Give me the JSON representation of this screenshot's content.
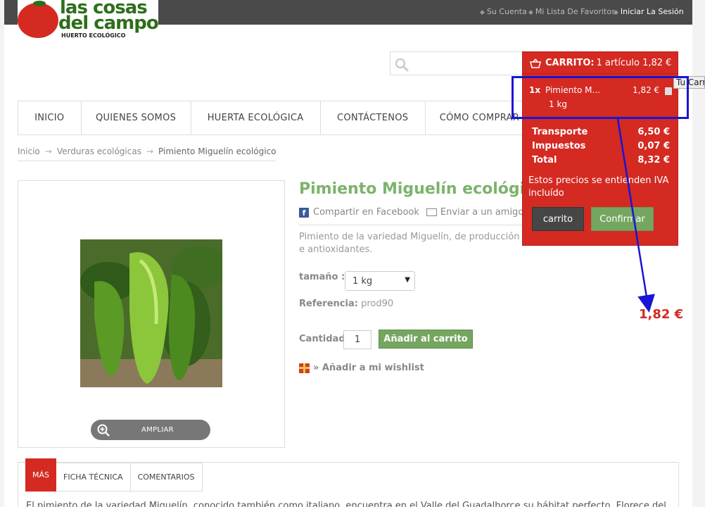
{
  "header": {
    "links": [
      {
        "label": "Su Cuenta"
      },
      {
        "label": "Mi Lista De Favoritos"
      },
      {
        "label": "Iniciar La Sesión"
      }
    ],
    "logo": {
      "line1": "las cosas",
      "line2": "del campo",
      "line3": "HUERTO ECOLÓGICO"
    }
  },
  "search": {
    "placeholder": "",
    "value": ""
  },
  "nav": {
    "items": [
      {
        "label": "INICIO"
      },
      {
        "label": "QUIENES SOMOS"
      },
      {
        "label": "HUERTA ECOLÓGICA"
      },
      {
        "label": "CONTÁCTENOS"
      },
      {
        "label": "CÓMO COMPRAR"
      }
    ]
  },
  "breadcrumb": {
    "items": [
      "Inicio",
      "Verduras ecológicas",
      "Pimiento Miguelín ecológico"
    ]
  },
  "product": {
    "title": "Pimiento Miguelín ecológico",
    "share_facebook": "Compartir en Facebook",
    "send_friend": "Enviar a un amigo",
    "description": "Pimiento de la variedad Miguelín, de producción e antioxidantes.",
    "size_label": "tamaño :",
    "size_value": "1 kg",
    "reference_label": "Referencia:",
    "reference_value": "prod90",
    "quantity_label": "Cantidad",
    "quantity_value": "1",
    "add_to_cart": "Añadir al carrito",
    "wishlist": "» Añadir a mi wishlist",
    "zoom_label": "AMPLIAR"
  },
  "tabs": {
    "items": [
      {
        "label": "MÁS",
        "active": true
      },
      {
        "label": "FICHA TÉCNICA",
        "active": false
      },
      {
        "label": "COMENTARIOS",
        "active": false
      }
    ],
    "content": "El pimiento de la variedad Miguelín, conocido también como italiano, encuentra en el Valle del Guadalhorce su hábitat perfecto. Florece del"
  },
  "cart": {
    "title": "CARRITO:",
    "summary": "1 artículo 1,82 €",
    "item": {
      "qty": "1x",
      "name": "Pimiento M...",
      "price": "1,82 €",
      "attribute": "1 kg"
    },
    "totals": [
      {
        "label": "Transporte",
        "value": "6,50 €"
      },
      {
        "label": "Impuestos",
        "value": "0,07 €"
      },
      {
        "label": "Total",
        "value": "8,32 €"
      }
    ],
    "note": "Estos precios se entienden IVA incluído",
    "btn_cart": "carrito",
    "btn_confirm": "Confirmar",
    "tooltip": "Tu Carrito"
  },
  "annotation": {
    "price": "1,82 €",
    "color": "#1a14d4"
  },
  "colors": {
    "brand_red": "#d42a22",
    "brand_green": "#7cb36b",
    "button_green": "#74a660",
    "topbar": "#4a4a4a"
  }
}
